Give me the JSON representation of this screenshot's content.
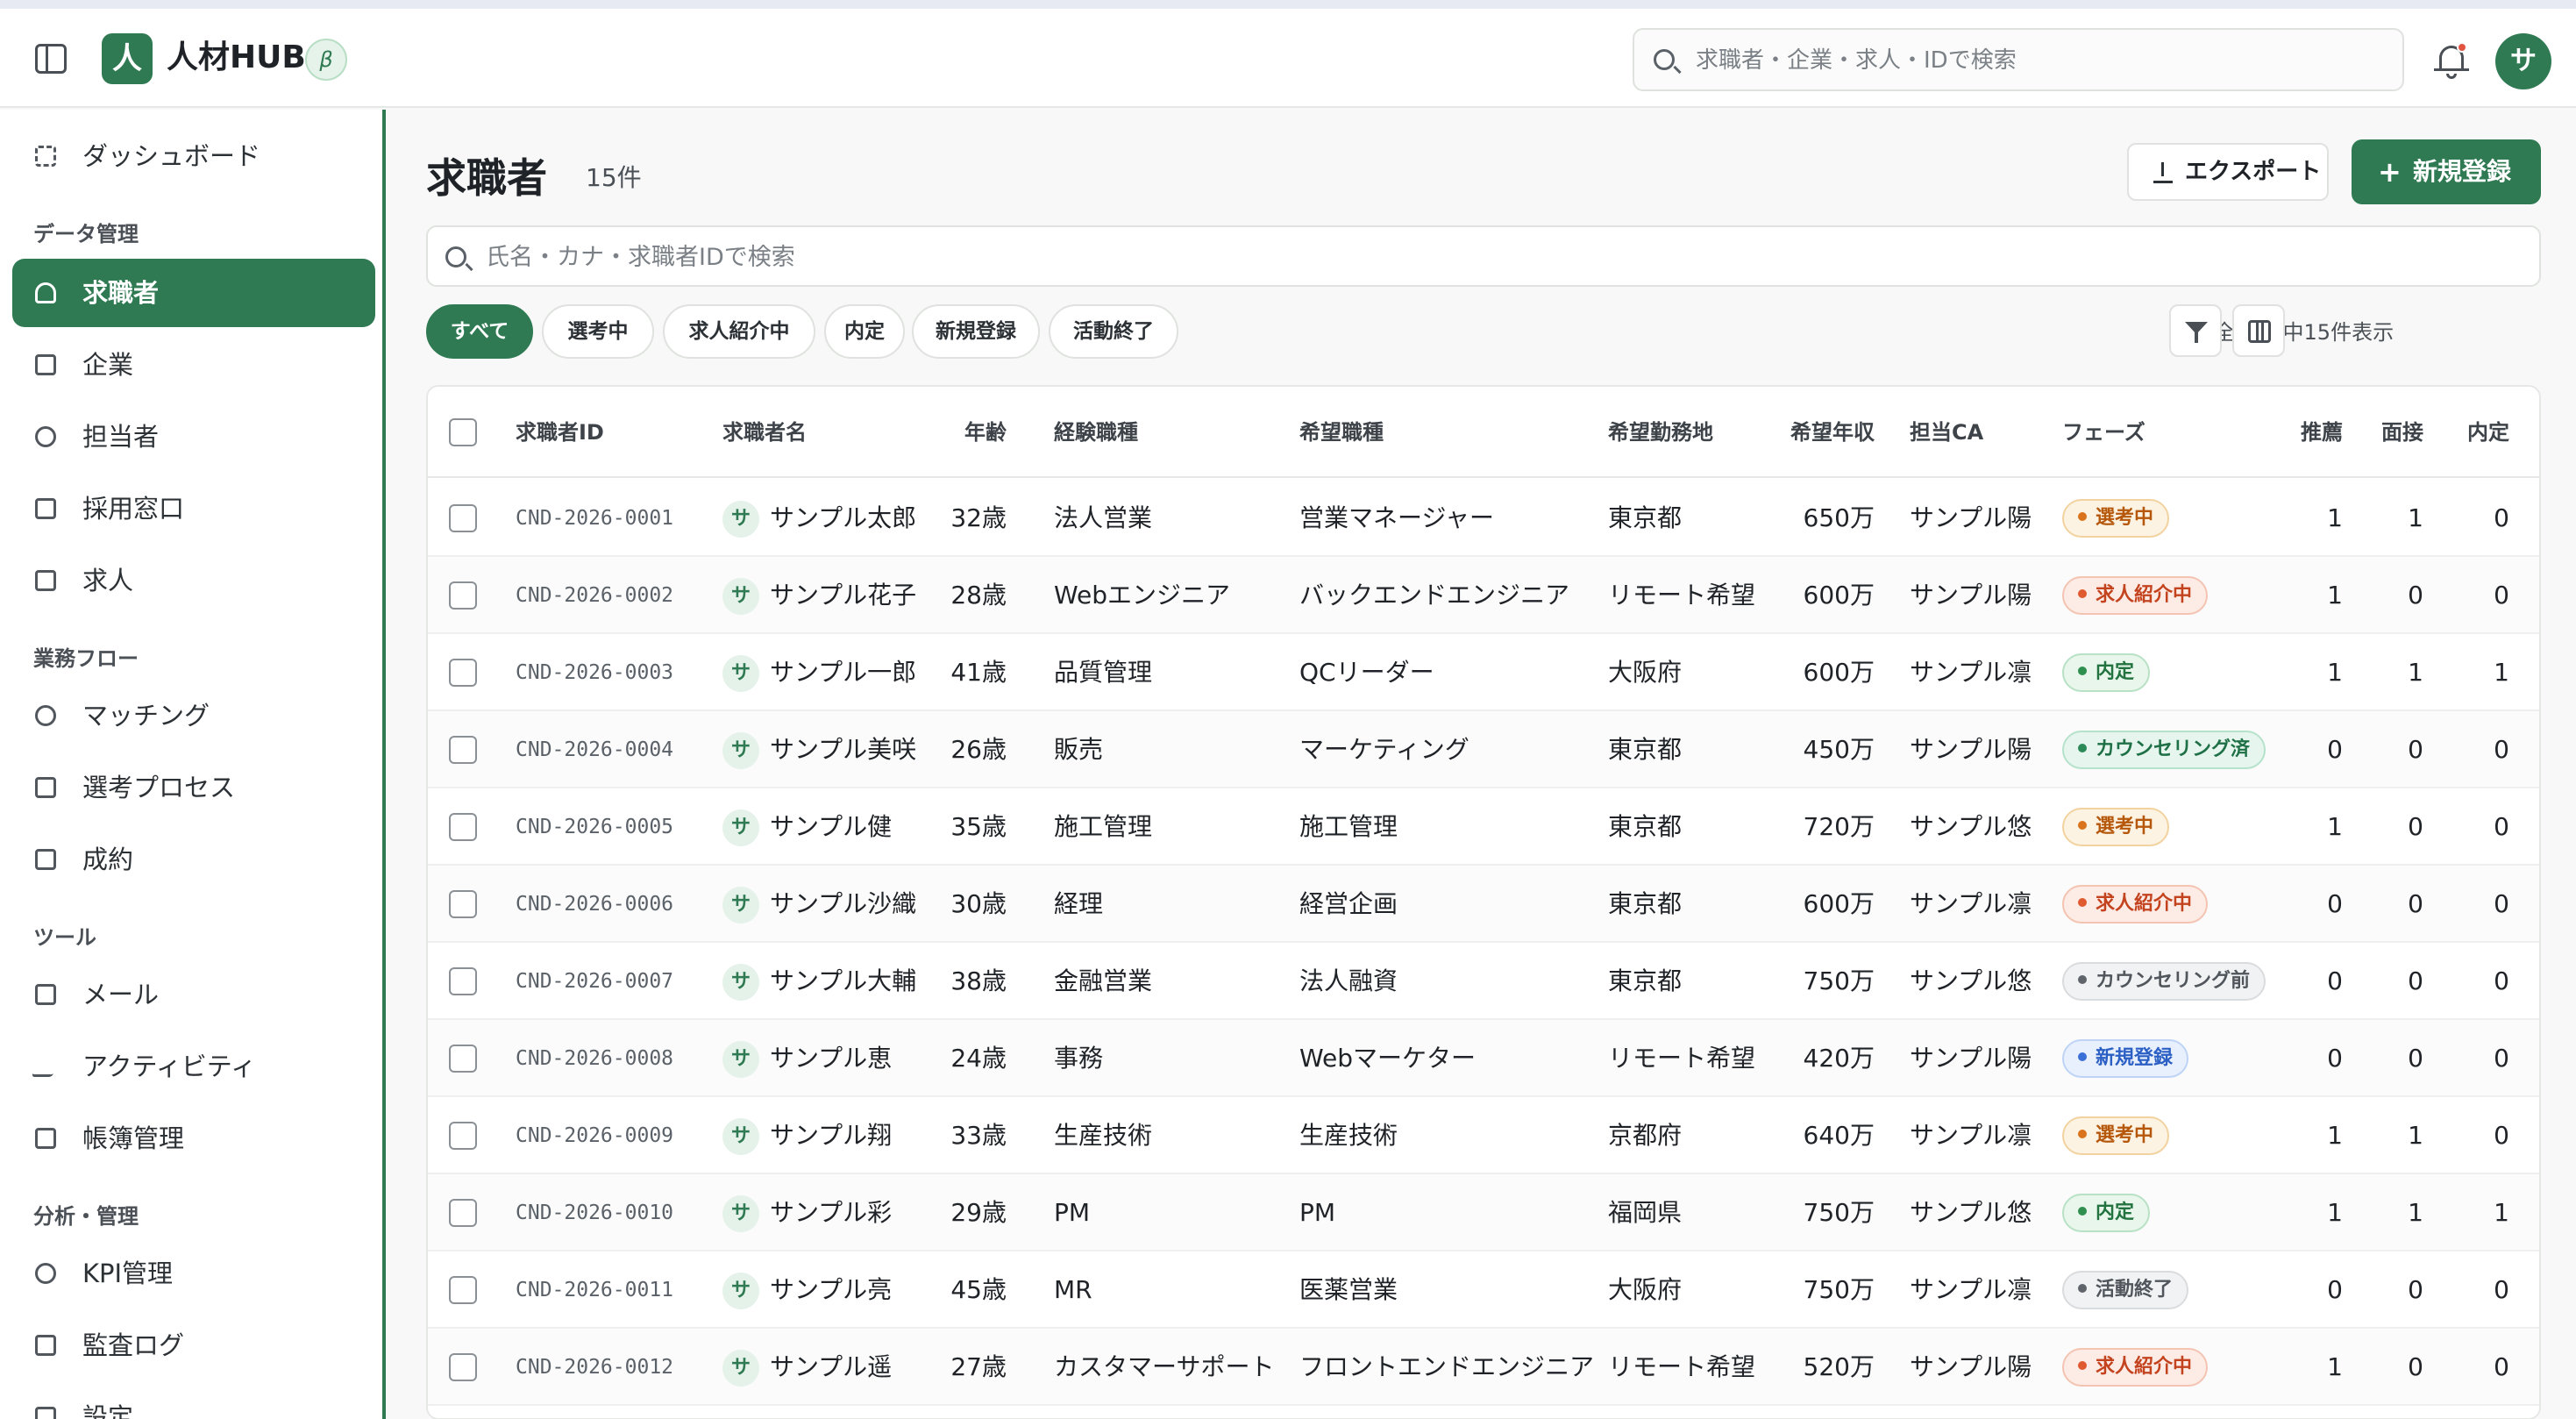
{
  "app": {
    "logo_char": "人",
    "name": "人材HUB",
    "beta": "β"
  },
  "header": {
    "search_placeholder": "求職者・企業・求人・IDで検索",
    "avatar": "サ"
  },
  "sidebar": {
    "top": [
      {
        "label": "ダッシュボード",
        "icon": "dashboard-icon"
      }
    ],
    "sections": [
      {
        "title": "データ管理",
        "items": [
          {
            "label": "求職者",
            "icon": "user-icon",
            "active": true
          },
          {
            "label": "企業",
            "icon": "building-icon"
          },
          {
            "label": "担当者",
            "icon": "users-icon"
          },
          {
            "label": "採用窓口",
            "icon": "store-icon"
          },
          {
            "label": "求人",
            "icon": "briefcase-icon"
          }
        ]
      },
      {
        "title": "業務フロー",
        "items": [
          {
            "label": "マッチング",
            "icon": "sparkle-icon"
          },
          {
            "label": "選考プロセス",
            "icon": "git-branch-icon"
          },
          {
            "label": "成約",
            "icon": "trophy-icon"
          }
        ]
      },
      {
        "title": "ツール",
        "items": [
          {
            "label": "メール",
            "icon": "mail-icon"
          },
          {
            "label": "アクティビティ",
            "icon": "activity-icon"
          },
          {
            "label": "帳簿管理",
            "icon": "document-icon"
          }
        ]
      },
      {
        "title": "分析・管理",
        "items": [
          {
            "label": "KPI管理",
            "icon": "target-icon"
          },
          {
            "label": "監査ログ",
            "icon": "log-icon"
          },
          {
            "label": "設定",
            "icon": "gear-icon"
          }
        ]
      }
    ]
  },
  "page": {
    "title": "求職者",
    "count": "15件",
    "export_label": "エクスポート",
    "new_label": "新規登録",
    "new_plus": "+",
    "search_placeholder": "氏名・カナ・求職者IDで検索",
    "showing": "全15件中15件表示"
  },
  "filters": [
    "すべて",
    "選考中",
    "求人紹介中",
    "内定",
    "新規登録",
    "活動終了"
  ],
  "table": {
    "headers": {
      "id": "求職者ID",
      "name": "求職者名",
      "age": "年齢",
      "exp": "経験職種",
      "desired": "希望職種",
      "location": "希望勤務地",
      "salary": "希望年収",
      "ca": "担当CA",
      "phase": "フェーズ",
      "rec": "推薦",
      "interview": "面接",
      "offer": "内定"
    },
    "avatar_char": "サ",
    "rows": [
      {
        "id": "CND-2026-0001",
        "name": "サンプル太郎",
        "age": "32歳",
        "exp": "法人営業",
        "desired": "営業マネージャー",
        "location": "東京都",
        "salary": "650万",
        "ca": "サンプル陽",
        "phase": "選考中",
        "phase_color": "orange",
        "rec": "1",
        "interview": "1",
        "offer": "0"
      },
      {
        "id": "CND-2026-0002",
        "name": "サンプル花子",
        "age": "28歳",
        "exp": "Webエンジニア",
        "desired": "バックエンドエンジニア",
        "location": "リモート希望",
        "salary": "600万",
        "ca": "サンプル陽",
        "phase": "求人紹介中",
        "phase_color": "red",
        "rec": "1",
        "interview": "0",
        "offer": "0"
      },
      {
        "id": "CND-2026-0003",
        "name": "サンプル一郎",
        "age": "41歳",
        "exp": "品質管理",
        "desired": "QCリーダー",
        "location": "大阪府",
        "salary": "600万",
        "ca": "サンプル凛",
        "phase": "内定",
        "phase_color": "green",
        "rec": "1",
        "interview": "1",
        "offer": "1"
      },
      {
        "id": "CND-2026-0004",
        "name": "サンプル美咲",
        "age": "26歳",
        "exp": "販売",
        "desired": "マーケティング",
        "location": "東京都",
        "salary": "450万",
        "ca": "サンプル陽",
        "phase": "カウンセリング済",
        "phase_color": "teal",
        "rec": "0",
        "interview": "0",
        "offer": "0"
      },
      {
        "id": "CND-2026-0005",
        "name": "サンプル健",
        "age": "35歳",
        "exp": "施工管理",
        "desired": "施工管理",
        "location": "東京都",
        "salary": "720万",
        "ca": "サンプル悠",
        "phase": "選考中",
        "phase_color": "orange",
        "rec": "1",
        "interview": "0",
        "offer": "0"
      },
      {
        "id": "CND-2026-0006",
        "name": "サンプル沙織",
        "age": "30歳",
        "exp": "経理",
        "desired": "経営企画",
        "location": "東京都",
        "salary": "600万",
        "ca": "サンプル凛",
        "phase": "求人紹介中",
        "phase_color": "red",
        "rec": "0",
        "interview": "0",
        "offer": "0"
      },
      {
        "id": "CND-2026-0007",
        "name": "サンプル大輔",
        "age": "38歳",
        "exp": "金融営業",
        "desired": "法人融資",
        "location": "東京都",
        "salary": "750万",
        "ca": "サンプル悠",
        "phase": "カウンセリング前",
        "phase_color": "gray",
        "rec": "0",
        "interview": "0",
        "offer": "0"
      },
      {
        "id": "CND-2026-0008",
        "name": "サンプル恵",
        "age": "24歳",
        "exp": "事務",
        "desired": "Webマーケター",
        "location": "リモート希望",
        "salary": "420万",
        "ca": "サンプル陽",
        "phase": "新規登録",
        "phase_color": "blue",
        "rec": "0",
        "interview": "0",
        "offer": "0"
      },
      {
        "id": "CND-2026-0009",
        "name": "サンプル翔",
        "age": "33歳",
        "exp": "生産技術",
        "desired": "生産技術",
        "location": "京都府",
        "salary": "640万",
        "ca": "サンプル凛",
        "phase": "選考中",
        "phase_color": "orange",
        "rec": "1",
        "interview": "1",
        "offer": "0"
      },
      {
        "id": "CND-2026-0010",
        "name": "サンプル彩",
        "age": "29歳",
        "exp": "PM",
        "desired": "PM",
        "location": "福岡県",
        "salary": "750万",
        "ca": "サンプル悠",
        "phase": "内定",
        "phase_color": "green",
        "rec": "1",
        "interview": "1",
        "offer": "1"
      },
      {
        "id": "CND-2026-0011",
        "name": "サンプル亮",
        "age": "45歳",
        "exp": "MR",
        "desired": "医薬営業",
        "location": "大阪府",
        "salary": "750万",
        "ca": "サンプル凛",
        "phase": "活動終了",
        "phase_color": "gray",
        "rec": "0",
        "interview": "0",
        "offer": "0"
      },
      {
        "id": "CND-2026-0012",
        "name": "サンプル遥",
        "age": "27歳",
        "exp": "カスタマーサポート",
        "desired": "フロントエンドエンジニア",
        "location": "リモート希望",
        "salary": "520万",
        "ca": "サンプル陽",
        "phase": "求人紹介中",
        "phase_color": "red",
        "rec": "1",
        "interview": "0",
        "offer": "0"
      }
    ]
  },
  "colors": {
    "accent": "#2f7a52",
    "orange": {
      "bg": "#fdf3e2",
      "border": "#f2d3a0",
      "fg": "#b5580c",
      "dot": "#d9731c"
    },
    "red": {
      "bg": "#fdece6",
      "border": "#f4c3b2",
      "fg": "#c4431f",
      "dot": "#df5a2e"
    },
    "green": {
      "bg": "#e8f6ec",
      "border": "#b8e1c5",
      "fg": "#22733f",
      "dot": "#2f8f4e"
    },
    "teal": {
      "bg": "#e6f6ee",
      "border": "#b5e2cb",
      "fg": "#1f7046",
      "dot": "#2b8a57"
    },
    "gray": {
      "bg": "#f1f2f3",
      "border": "#d9dcdf",
      "fg": "#50565c",
      "dot": "#5f656b"
    },
    "blue": {
      "bg": "#e8f0fd",
      "border": "#bed3f6",
      "fg": "#2b5fc4",
      "dot": "#3a6fd8"
    }
  }
}
